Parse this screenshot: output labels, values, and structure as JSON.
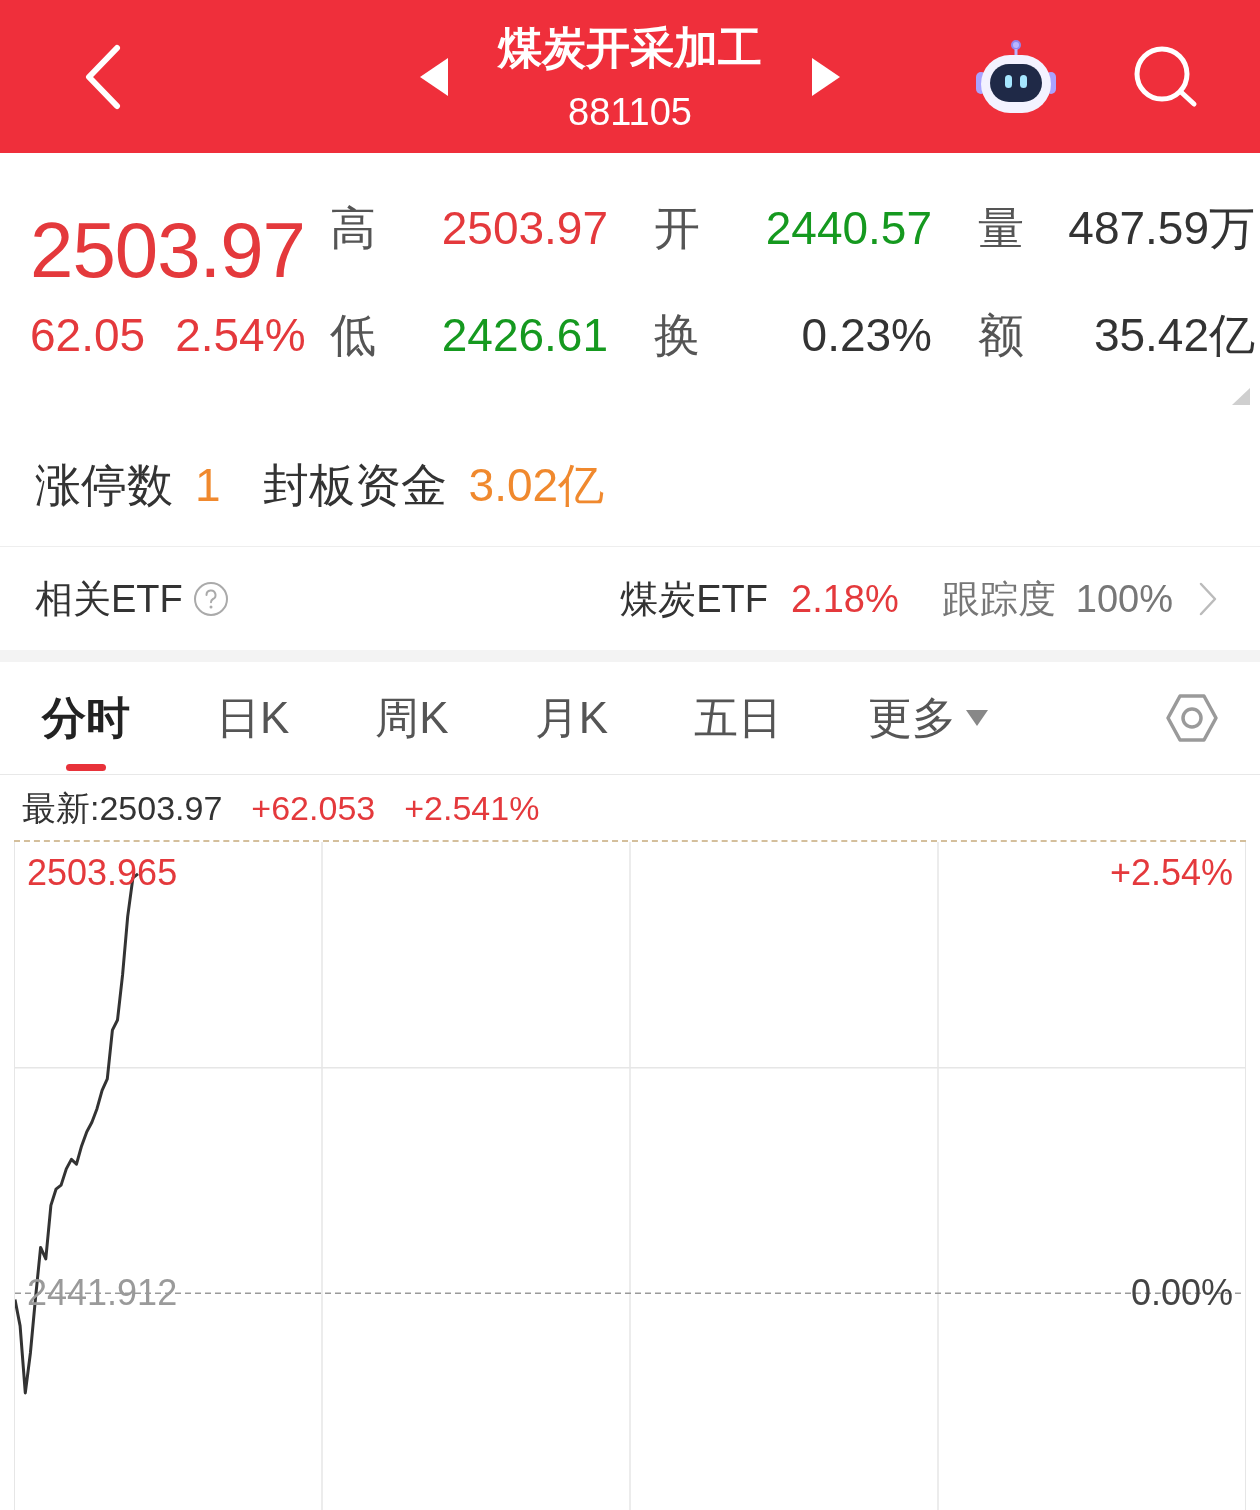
{
  "header": {
    "title": "煤炭开采加工",
    "code": "881105"
  },
  "quote": {
    "price": "2503.97",
    "change": "62.05",
    "change_pct": "2.54%"
  },
  "stats": [
    {
      "label": "高",
      "value": "2503.97",
      "color": "#e4393c"
    },
    {
      "label": "开",
      "value": "2440.57",
      "color": "#15991f"
    },
    {
      "label": "量",
      "value": "487.59万",
      "color": "#333333"
    },
    {
      "label": "低",
      "value": "2426.61",
      "color": "#15991f"
    },
    {
      "label": "换",
      "value": "0.23%",
      "color": "#333333"
    },
    {
      "label": "额",
      "value": "35.42亿",
      "color": "#333333"
    }
  ],
  "limit_info": [
    {
      "label": "涨停数",
      "value": "1"
    },
    {
      "label": "封板资金",
      "value": "3.02亿"
    }
  ],
  "etf": {
    "label": "相关ETF",
    "name": "煤炭ETF",
    "change": "2.18%",
    "tracking_label": "跟踪度",
    "tracking": "100%"
  },
  "tabs": [
    {
      "label": "分时",
      "selected": true,
      "kind": "tab"
    },
    {
      "label": "日K",
      "selected": false,
      "kind": "tab"
    },
    {
      "label": "周K",
      "selected": false,
      "kind": "tab"
    },
    {
      "label": "月K",
      "selected": false,
      "kind": "tab"
    },
    {
      "label": "五日",
      "selected": false,
      "kind": "tab"
    },
    {
      "label": "更多",
      "selected": false,
      "kind": "dropdown"
    }
  ],
  "chart": {
    "latest": "最新:2503.97",
    "change": "+62.053",
    "change_pct": "+2.541%",
    "right_labels": [
      "+2.54%",
      "0.00%"
    ],
    "chart_data": {
      "type": "line",
      "categories": [
        null,
        null,
        null,
        null,
        null,
        null,
        null,
        null,
        null,
        null,
        null,
        null,
        null,
        null,
        null,
        null,
        null,
        null,
        null,
        null,
        null,
        null,
        null,
        null,
        null,
        null,
        null,
        null,
        null,
        null,
        null,
        null,
        null,
        null,
        null,
        null,
        null,
        null,
        null,
        null,
        null,
        null,
        null,
        null,
        null,
        null,
        null,
        null,
        null,
        null,
        null,
        null,
        null,
        null,
        null,
        null,
        null,
        null,
        null,
        null,
        null,
        null,
        null,
        null,
        null,
        null,
        null,
        null,
        null,
        null,
        null,
        null,
        null,
        null,
        null,
        null,
        null,
        null,
        null,
        null,
        null,
        null,
        null,
        null,
        null,
        null,
        null,
        null,
        null,
        null,
        null,
        null,
        null,
        null,
        null,
        null,
        null,
        null,
        null,
        null,
        null,
        null,
        null,
        null,
        null,
        null,
        null,
        null,
        null,
        null,
        null,
        null,
        null,
        null,
        null,
        null,
        null,
        null,
        null,
        null,
        null,
        null,
        null,
        null,
        null,
        null,
        null,
        null,
        null,
        null,
        null,
        null,
        null,
        null,
        null,
        null,
        null,
        null,
        null,
        null,
        null,
        null,
        null,
        null,
        null,
        null,
        null,
        null,
        null,
        null,
        null,
        null,
        null,
        null,
        null,
        null,
        null,
        null,
        null,
        null,
        null,
        null,
        null,
        null,
        null,
        null,
        null,
        null,
        null,
        null,
        null,
        null,
        null,
        null,
        null,
        null,
        null,
        null,
        null,
        null,
        null,
        null,
        null,
        null,
        null,
        null,
        null,
        null,
        null,
        null,
        null,
        null,
        null,
        null,
        null,
        null,
        null,
        null,
        null,
        null,
        null,
        null,
        null,
        null,
        null,
        null,
        null,
        null,
        null,
        null,
        null,
        null,
        null,
        null,
        null,
        null,
        null,
        null,
        null,
        null,
        null,
        null,
        null,
        null,
        null,
        null,
        null,
        null,
        null,
        null,
        null,
        null,
        null,
        null,
        null,
        null,
        null,
        null,
        null,
        null,
        null
      ],
      "values": [
        2441.0,
        2437.1,
        2427.2,
        2433.1,
        2441.2,
        2448.7,
        2447.0,
        2454.9,
        2457.3,
        2457.9,
        2460.3,
        2461.7,
        2461.0,
        2463.7,
        2465.8,
        2467.2,
        2469.2,
        2471.9,
        2473.6,
        2480.8,
        2482.3,
        2489.0,
        2497.6,
        2503.3,
        2503.9,
        null,
        null,
        null,
        null,
        null,
        null,
        null,
        null,
        null,
        null,
        null,
        null,
        null,
        null,
        null,
        null,
        null,
        null,
        null,
        null,
        null,
        null,
        null,
        null,
        null,
        null,
        null,
        null,
        null,
        null,
        null,
        null,
        null,
        null,
        null,
        null,
        null,
        null,
        null,
        null,
        null,
        null,
        null,
        null,
        null,
        null,
        null,
        null,
        null,
        null,
        null,
        null,
        null,
        null,
        null,
        null,
        null,
        null,
        null,
        null,
        null,
        null,
        null,
        null,
        null,
        null,
        null,
        null,
        null,
        null,
        null,
        null,
        null,
        null,
        null,
        null,
        null,
        null,
        null,
        null,
        null,
        null,
        null,
        null,
        null,
        null,
        null,
        null,
        null,
        null,
        null,
        null,
        null,
        null,
        null,
        null,
        null,
        null,
        null,
        null,
        null,
        null,
        null,
        null,
        null,
        null,
        null,
        null,
        null,
        null,
        null,
        null,
        null,
        null,
        null,
        null,
        null,
        null,
        null,
        null,
        null,
        null,
        null,
        null,
        null,
        null,
        null,
        null,
        null,
        null,
        null,
        null,
        null,
        null,
        null,
        null,
        null,
        null,
        null,
        null,
        null,
        null,
        null,
        null,
        null,
        null,
        null,
        null,
        null,
        null,
        null,
        null,
        null,
        null,
        null,
        null,
        null,
        null,
        null,
        null,
        null,
        null,
        null,
        null,
        null,
        null,
        null,
        null,
        null,
        null,
        null,
        null,
        null,
        null,
        null,
        null,
        null,
        null,
        null,
        null,
        null,
        null,
        null,
        null,
        null,
        null,
        null,
        null,
        null,
        null,
        null,
        null,
        null,
        null,
        null,
        null,
        null,
        null,
        null,
        null,
        null,
        null,
        null,
        null,
        null,
        null,
        null,
        null,
        null,
        null,
        null,
        null,
        null,
        null,
        null,
        null
      ],
      "ylim": [
        2409.9,
        2508.6
      ],
      "yticks": [
        {
          "value": 2503.965,
          "label": "2503.965"
        },
        {
          "value": 2441.912,
          "label": "2441.912"
        }
      ],
      "ref_lines": [
        {
          "axis": "y",
          "value": 2441.912
        }
      ]
    }
  }
}
